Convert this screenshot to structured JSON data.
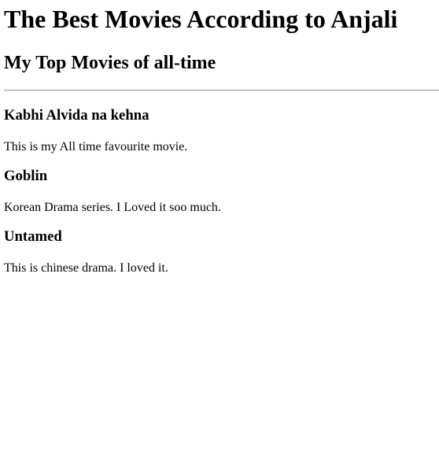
{
  "page": {
    "title": "The Best Movies According to Anjali",
    "subtitle": "My Top Movies of all-time"
  },
  "movies": [
    {
      "title": "Kabhi Alvida na kehna",
      "description": "This is my All time favourite movie."
    },
    {
      "title": "Goblin",
      "description": "Korean Drama series. I Loved it soo much."
    },
    {
      "title": "Untamed",
      "description": "This is chinese drama. I loved it."
    }
  ]
}
